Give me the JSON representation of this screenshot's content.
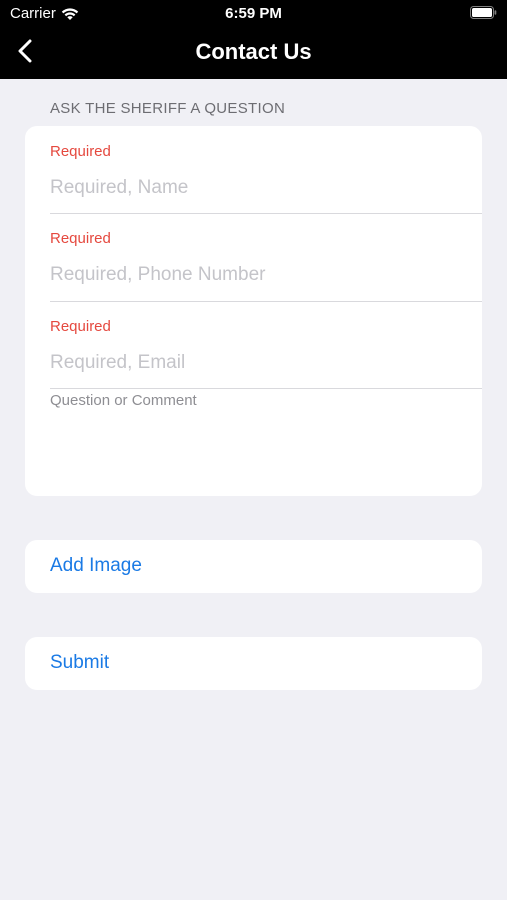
{
  "status_bar": {
    "carrier": "Carrier",
    "time": "6:59 PM",
    "icons": [
      "wifi-icon",
      "battery-icon"
    ]
  },
  "nav": {
    "title": "Contact Us",
    "back_icon": "chevron-left-icon"
  },
  "form": {
    "section_header": "ASK THE SHERIFF A QUESTION",
    "fields": [
      {
        "label": "Required",
        "placeholder": "Required, Name",
        "value": ""
      },
      {
        "label": "Required",
        "placeholder": "Required, Phone Number",
        "value": ""
      },
      {
        "label": "Required",
        "placeholder": "Required, Email",
        "value": ""
      }
    ],
    "comment": {
      "placeholder": "Question or Comment",
      "value": ""
    }
  },
  "actions": {
    "add_image_label": "Add Image",
    "submit_label": "Submit"
  },
  "colors": {
    "nav_background": "#000000",
    "page_background": "#f0f0f5",
    "required_red": "#e5493f",
    "action_blue": "#1a7ae5"
  }
}
